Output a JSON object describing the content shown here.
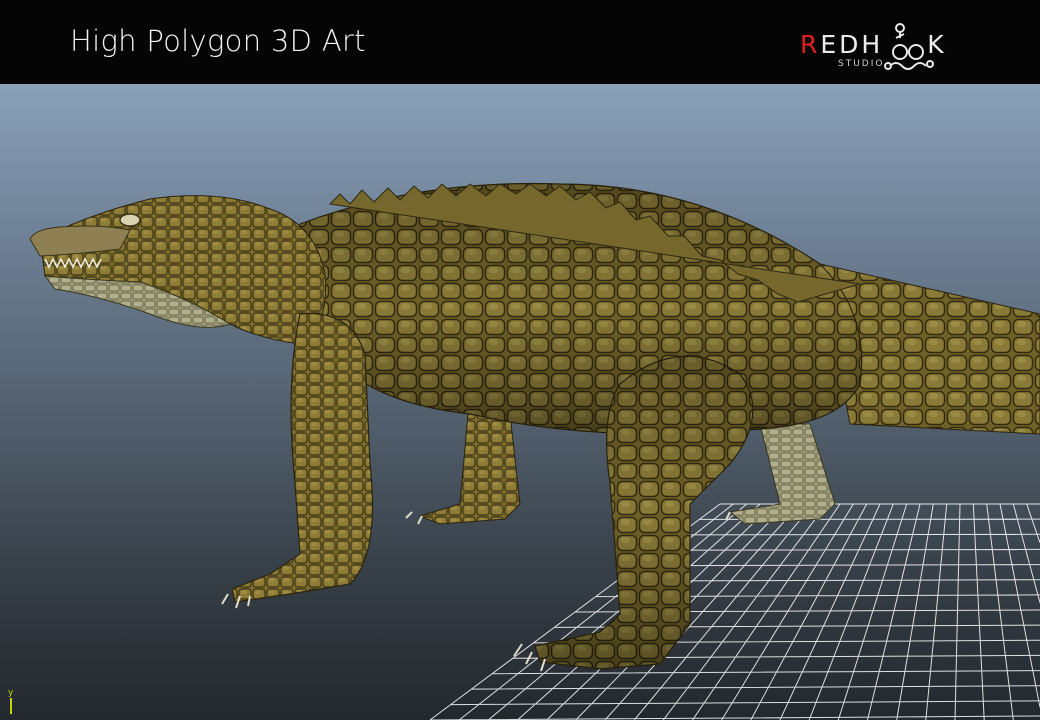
{
  "header": {
    "title": "High Polygon 3D Art",
    "logo": {
      "first_letter": "R",
      "rest": "EDH",
      "tail": "K",
      "subtitle": "STUDIO",
      "accent_color": "#e02020"
    }
  },
  "viewport": {
    "subject": "crocodile",
    "background_top": "#8aa1ba",
    "background_bottom": "#23282d",
    "grid_color": "#ffffff",
    "axis_label": "y",
    "axis_color": "#c8d400"
  }
}
